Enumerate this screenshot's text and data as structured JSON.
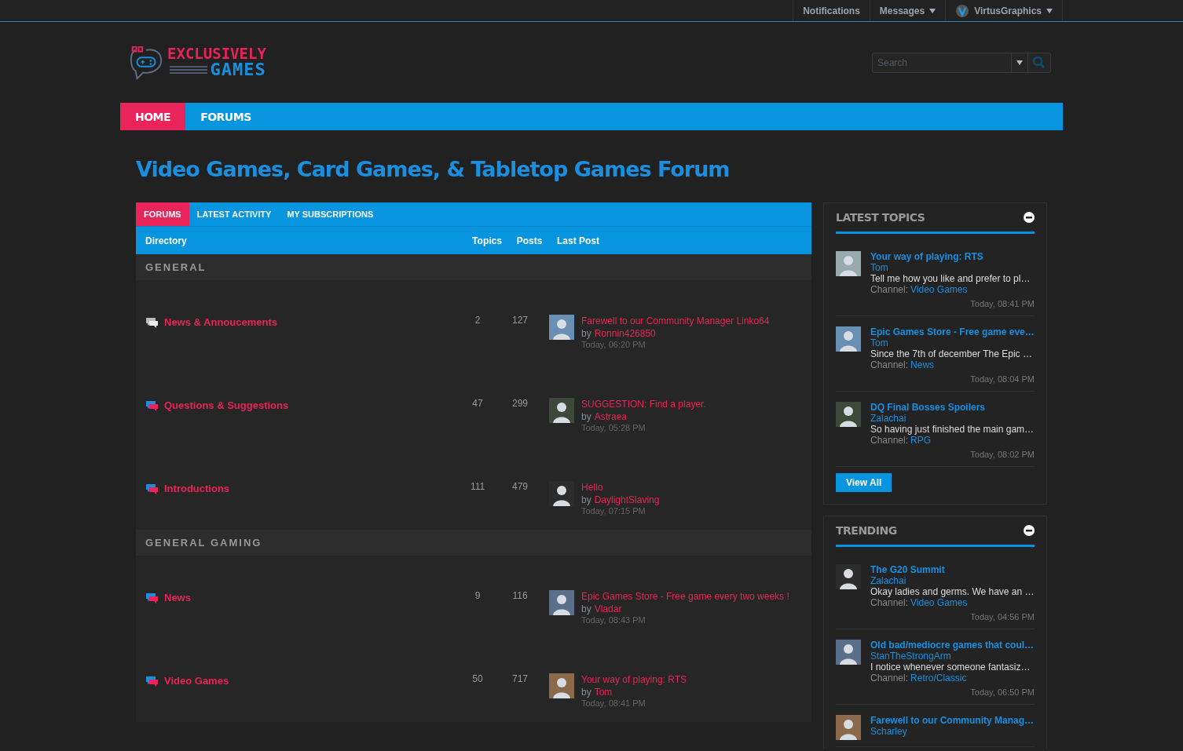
{
  "top_bar": [
    {
      "label": "Notifications",
      "kind": "link"
    },
    {
      "label": "Messages",
      "kind": "menu"
    },
    {
      "label": "VirtusGraphics",
      "kind": "user-menu"
    }
  ],
  "logo": {
    "line1": "EXCLUSIVELY",
    "line2": "GAMES"
  },
  "search": {
    "placeholder": "Search"
  },
  "nav": [
    {
      "label": "HOME",
      "selected": true
    },
    {
      "label": "FORUMS",
      "selected": false
    }
  ],
  "page_title": "Video Games, Card Games, & Tabletop Games Forum",
  "forum_tabs": [
    {
      "label": "FORUMS",
      "selected": true
    },
    {
      "label": "LATEST ACTIVITY",
      "selected": false
    },
    {
      "label": "MY SUBSCRIPTIONS",
      "selected": false
    }
  ],
  "columns": {
    "directory": "Directory",
    "topics": "Topics",
    "posts": "Posts",
    "last_post": "Last Post"
  },
  "sections": [
    {
      "title": "GENERAL",
      "forums": [
        {
          "name": "News & Annoucements",
          "unread": false,
          "topics": "2",
          "posts": "127",
          "last_post": {
            "title": "Farewell to our Community Manager Linko64",
            "by": "by",
            "author": "Ronnin426850",
            "time": "Today, 06:20 PM"
          }
        },
        {
          "name": "Questions & Suggestions",
          "unread": true,
          "topics": "47",
          "posts": "299",
          "last_post": {
            "title": "SUGGESTION: Find a player.",
            "by": "by",
            "author": "Astraea",
            "time": "Today, 05:28 PM"
          }
        },
        {
          "name": "Introductions",
          "unread": true,
          "topics": "111",
          "posts": "479",
          "last_post": {
            "title": "Hello",
            "by": "by",
            "author": "DaylightSlaving",
            "time": "Today, 07:15 PM"
          }
        }
      ]
    },
    {
      "title": "GENERAL GAMING",
      "forums": [
        {
          "name": "News",
          "unread": true,
          "topics": "9",
          "posts": "116",
          "last_post": {
            "title": "Epic Games Store - Free game every two weeks !",
            "by": "by",
            "author": "Vladar",
            "time": "Today, 08:43 PM"
          }
        },
        {
          "name": "Video Games",
          "unread": true,
          "topics": "50",
          "posts": "717",
          "last_post": {
            "title": "Your way of playing: RTS",
            "by": "by",
            "author": "Tom",
            "time": "Today, 08:41 PM"
          }
        }
      ]
    }
  ],
  "widgets": [
    {
      "title": "LATEST TOPICS",
      "expanded": true,
      "items": [
        {
          "title": "Your way of playing: RTS",
          "author": "Tom",
          "excerpt": "Tell me how you like and prefer to pl…",
          "channel_label": "Channel:",
          "channel": "Video Games",
          "time": "Today, 08:41 PM"
        },
        {
          "title": "Epic Games Store - Free game eve…",
          "author": "Tom",
          "excerpt": "Since the 7th of december The Epic …",
          "channel_label": "Channel:",
          "channel": "News",
          "time": "Today, 08:04 PM"
        },
        {
          "title": "DQ Final Bosses Spoilers",
          "author": "Zalachai",
          "excerpt": "So having just finished the main gam…",
          "channel_label": "Channel:",
          "channel": "RPG",
          "time": "Today, 08:02 PM"
        }
      ],
      "button": "View All"
    },
    {
      "title": "TRENDING",
      "expanded": true,
      "items": [
        {
          "title": "The G20 Summit",
          "author": "Zalachai",
          "excerpt": "Okay ladies and germs. We have an …",
          "channel_label": "Channel:",
          "channel": "Video Games",
          "time": "Today, 04:56 PM"
        },
        {
          "title": "Old bad/mediocre games that coul…",
          "author": "StanTheStrongArm",
          "excerpt": "I notice whenever someone fantasiz…",
          "channel_label": "Channel:",
          "channel": "Retro/Classic",
          "time": "Today, 06:50 PM"
        },
        {
          "title": "Farewell to our Community Manag…",
          "author": "Scharley"
        }
      ]
    }
  ]
}
